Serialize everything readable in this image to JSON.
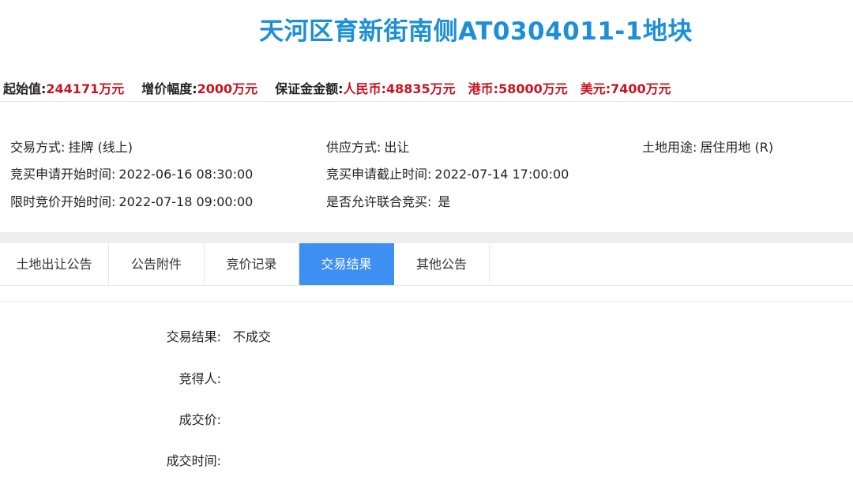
{
  "title": "天河区育新街南侧AT0304011-1地块",
  "summary": {
    "start_price_label": "起始值:",
    "start_price_value": "244171万元",
    "increment_label": "增价幅度:",
    "increment_value": "2000万元",
    "deposit_label": "保证金金额:",
    "rmb_label": "人民币:",
    "rmb_value": "48835万元",
    "hkd_label": "港币:",
    "hkd_value": "58000万元",
    "usd_label": "美元:",
    "usd_value": "7400万元"
  },
  "info": {
    "trade_method_label": "交易方式:",
    "trade_method_value": "挂牌 (线上)",
    "supply_method_label": "供应方式:",
    "supply_method_value": "出让",
    "land_use_label": "土地用途:",
    "land_use_value": "居住用地 (R)",
    "apply_start_label": "竞买申请开始时间:",
    "apply_start_value": "2022-06-16 08:30:00",
    "apply_end_label": "竞买申请截止时间:",
    "apply_end_value": "2022-07-14 17:00:00",
    "bid_start_label": "限时竞价开始时间:",
    "bid_start_value": "2022-07-18 09:00:00",
    "joint_bid_label": "是否允许联合竞买:",
    "joint_bid_value": "是"
  },
  "tabs": [
    {
      "label": "土地出让公告"
    },
    {
      "label": "公告附件"
    },
    {
      "label": "竞价记录"
    },
    {
      "label": "交易结果"
    },
    {
      "label": "其他公告"
    }
  ],
  "active_tab": "交易结果",
  "result": {
    "result_label": "交易结果:",
    "result_value": "不成交",
    "winner_label": "竞得人:",
    "winner_value": "",
    "price_label": "成交价:",
    "price_value": "",
    "time_label": "成交时间:",
    "time_value": ""
  },
  "colors": {
    "title": "#1c8fd6",
    "highlight": "#c8141e",
    "active_tab": "#3d8ff2"
  }
}
